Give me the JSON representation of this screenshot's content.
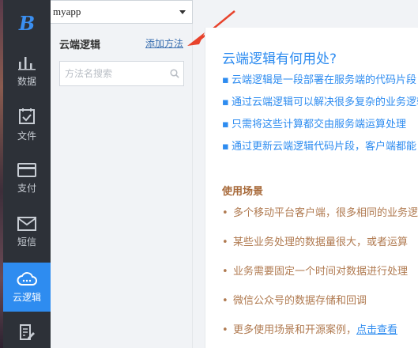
{
  "app_selector": {
    "value": "myapp"
  },
  "nav": [
    {
      "id": "data",
      "label": "数据",
      "icon": "bar-chart-icon"
    },
    {
      "id": "files",
      "label": "文件",
      "icon": "file-check-icon"
    },
    {
      "id": "payment",
      "label": "支付",
      "icon": "credit-card-icon"
    },
    {
      "id": "sms",
      "label": "短信",
      "icon": "mail-icon"
    },
    {
      "id": "cloud",
      "label": "云逻辑",
      "icon": "cloud-icon",
      "active": true
    },
    {
      "id": "more",
      "label": "",
      "icon": "edit-doc-icon"
    }
  ],
  "panel": {
    "title": "云端逻辑",
    "add_method": "添加方法",
    "search_placeholder": "方法名搜索"
  },
  "content": {
    "heading": "云端逻辑有何用处?",
    "uses": [
      "云端逻辑是一段部署在服务端的代码片段",
      "通过云端逻辑可以解决很多复杂的业务逻辑",
      "只需将这些计算都交由服务端运算处理",
      "通过更新云端逻辑代码片段，客户端都能"
    ],
    "scenarios_title": "使用场景",
    "scenarios": [
      "多个移动平台客户端，很多相同的业务逻辑",
      "某些业务处理的数据量很大，或者运算",
      "业务需要固定一个时间对数据进行处理",
      "微信公众号的数据存储和回调"
    ],
    "more_text": "更多使用场景和开源案例，",
    "more_link": "点击查看"
  },
  "colors": {
    "accent": "#2e8cf0",
    "sidebar": "#2d3138",
    "scenario_text": "#b07a50",
    "arrow": "#e8432c"
  }
}
